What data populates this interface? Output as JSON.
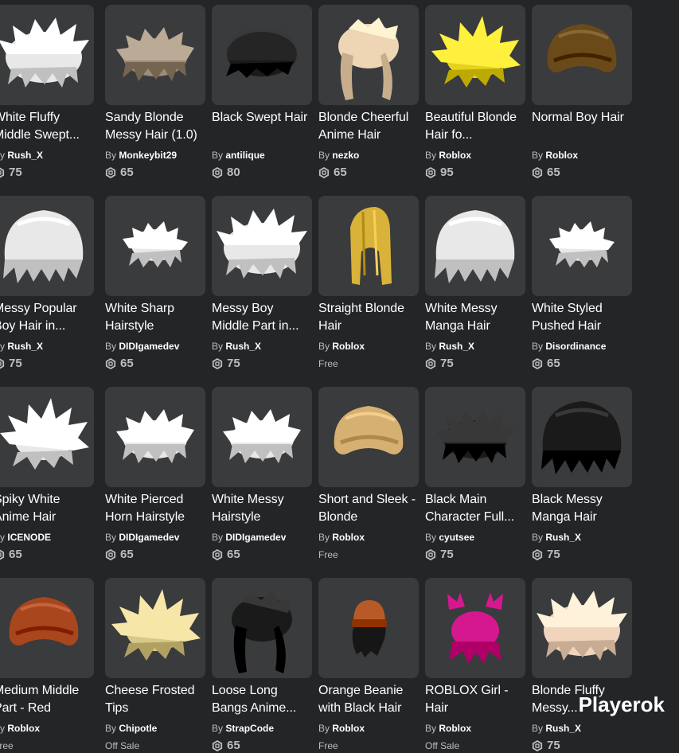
{
  "items": [
    {
      "name": "White Fluffy Middle Swept...",
      "by": "By",
      "creator": "Rush_X",
      "price": "75",
      "free": false,
      "hair": "white",
      "style": "fluffy"
    },
    {
      "name": "Sandy Blonde Messy Hair (1.0)",
      "by": "By",
      "creator": "Monkeybit29",
      "price": "65",
      "free": false,
      "hair": "sandy",
      "style": "messy"
    },
    {
      "name": "Black Swept Hair",
      "by": "By",
      "creator": "antilique",
      "price": "80",
      "free": false,
      "hair": "black",
      "style": "swept"
    },
    {
      "name": "Blonde Cheerful Anime Hair",
      "by": "By",
      "creator": "nezko",
      "price": "65",
      "free": false,
      "hair": "blonde-light",
      "style": "long"
    },
    {
      "name": "Beautiful Blonde Hair fo...",
      "by": "By",
      "creator": "Roblox",
      "price": "95",
      "free": false,
      "hair": "yellow",
      "style": "spiky"
    },
    {
      "name": "Normal Boy Hair",
      "by": "By",
      "creator": "Roblox",
      "price": "65",
      "free": false,
      "hair": "brown",
      "style": "cap"
    },
    {
      "name": "Messy Popular Boy Hair in...",
      "by": "By",
      "creator": "Rush_X",
      "price": "75",
      "free": false,
      "hair": "white",
      "style": "bowl"
    },
    {
      "name": "White Sharp Hairstyle",
      "by": "By",
      "creator": "DIDIgamedev",
      "price": "65",
      "free": false,
      "hair": "white",
      "style": "small"
    },
    {
      "name": "Messy Boy Middle Part in...",
      "by": "By",
      "creator": "Rush_X",
      "price": "75",
      "free": false,
      "hair": "white",
      "style": "fluffy"
    },
    {
      "name": "Straight Blonde Hair",
      "by": "By",
      "creator": "Roblox",
      "price": "Free",
      "free": true,
      "hair": "gold",
      "style": "straight"
    },
    {
      "name": "White Messy Manga Hair",
      "by": "By",
      "creator": "Rush_X",
      "price": "75",
      "free": false,
      "hair": "white",
      "style": "bowl"
    },
    {
      "name": "White Styled Pushed Hair",
      "by": "By",
      "creator": "Disordinance",
      "price": "65",
      "free": false,
      "hair": "white",
      "style": "small"
    },
    {
      "name": "Spiky White Anime Hair",
      "by": "By",
      "creator": "ICENODE",
      "price": "65",
      "free": false,
      "hair": "white",
      "style": "spiky"
    },
    {
      "name": "White Pierced Horn Hairstyle",
      "by": "By",
      "creator": "DIDIgamedev",
      "price": "65",
      "free": false,
      "hair": "white",
      "style": "messy"
    },
    {
      "name": "White Messy Hairstyle",
      "by": "By",
      "creator": "DIDIgamedev",
      "price": "65",
      "free": false,
      "hair": "white",
      "style": "messy"
    },
    {
      "name": "Short and Sleek - Blonde",
      "by": "By",
      "creator": "Roblox",
      "price": "Free",
      "free": true,
      "hair": "tan",
      "style": "cap"
    },
    {
      "name": "Black Main Character Full...",
      "by": "By",
      "creator": "cyutsee",
      "price": "75",
      "free": false,
      "hair": "black",
      "style": "messy"
    },
    {
      "name": "Black Messy Manga Hair",
      "by": "By",
      "creator": "Rush_X",
      "price": "75",
      "free": false,
      "hair": "black",
      "style": "bowl"
    },
    {
      "name": "Medium Middle Part - Red",
      "by": "By",
      "creator": "Roblox",
      "price": "Free",
      "free": true,
      "hair": "red",
      "style": "cap"
    },
    {
      "name": "Cheese Frosted Tips",
      "by": "By",
      "creator": "Chipotle",
      "price": "Off Sale",
      "free": true,
      "hair": "cheese",
      "style": "spiky"
    },
    {
      "name": "Loose Long Bangs Anime...",
      "by": "By",
      "creator": "StrapCode",
      "price": "65",
      "free": false,
      "hair": "black",
      "style": "long"
    },
    {
      "name": "Orange Beanie with Black Hair",
      "by": "By",
      "creator": "Roblox",
      "price": "Free",
      "free": true,
      "hair": "beanie",
      "style": "beanie"
    },
    {
      "name": "ROBLOX Girl - Hair",
      "by": "By",
      "creator": "Roblox",
      "price": "Off Sale",
      "free": true,
      "hair": "pink",
      "style": "pigtails"
    },
    {
      "name": "Blonde Fluffy Messy...",
      "by": "By",
      "creator": "Rush_X",
      "price": "75",
      "free": false,
      "hair": "peach",
      "style": "fluffy"
    }
  ],
  "colors": {
    "white": "#e8e8e8",
    "sandy": "#9c8c78",
    "black": "#1a1a1a",
    "blonde-light": "#eed6b4",
    "yellow": "#e5d21f",
    "brown": "#6b4a1a",
    "gold": "#d9b23a",
    "tan": "#d6b070",
    "red": "#a8461e",
    "cheese": "#d8c98a",
    "beanie": "#b85a28",
    "pink": "#d6188f",
    "peach": "#f0d4bc"
  },
  "icons": {
    "price": "robux-icon"
  },
  "watermark": "Playerok"
}
